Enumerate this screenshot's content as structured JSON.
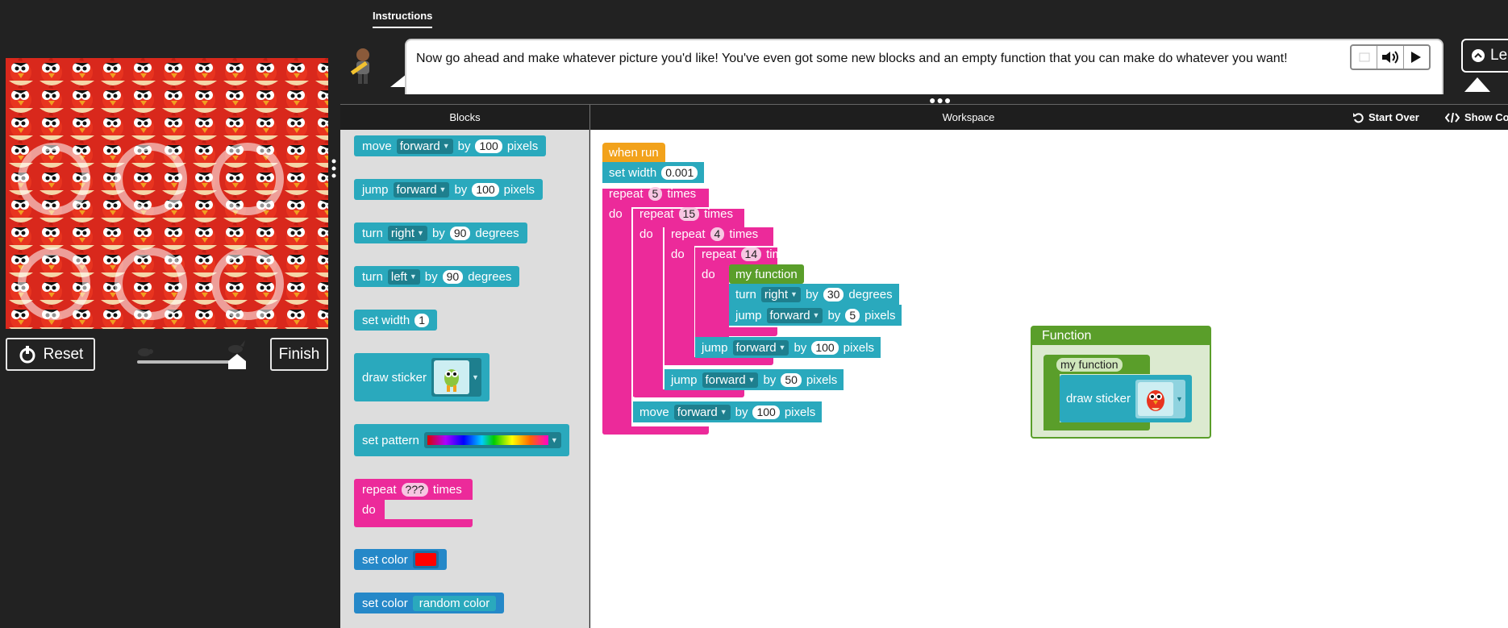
{
  "instructions": {
    "tab_label": "Instructions",
    "text": "Now go ahead and make whatever picture you'd like! You've even got some new blocks and an empty function that you can make do whatever you want!",
    "learn_label": "Le"
  },
  "stage": {
    "reset_label": "Reset",
    "finish_label": "Finish",
    "speed_level": 1.0
  },
  "header": {
    "blocks_label": "Blocks",
    "workspace_label": "Workspace",
    "start_over_label": "Start Over",
    "show_code_label": "Show Co"
  },
  "toolbox": {
    "move": {
      "label": "move",
      "dir": "forward",
      "by": "by",
      "value": "100",
      "unit": "pixels"
    },
    "jump": {
      "label": "jump",
      "dir": "forward",
      "by": "by",
      "value": "100",
      "unit": "pixels"
    },
    "turn_right": {
      "label": "turn",
      "dir": "right",
      "by": "by",
      "value": "90",
      "unit": "degrees"
    },
    "turn_left": {
      "label": "turn",
      "dir": "left",
      "by": "by",
      "value": "90",
      "unit": "degrees"
    },
    "set_width": {
      "label": "set width",
      "value": "1"
    },
    "draw_sticker": {
      "label": "draw sticker"
    },
    "set_pattern": {
      "label": "set pattern"
    },
    "repeat": {
      "label": "repeat",
      "value": "???",
      "unit": "times",
      "do": "do"
    },
    "set_color": {
      "label": "set color",
      "color": "#ff0000"
    },
    "set_color_random": {
      "label": "set color",
      "value": "random color"
    }
  },
  "workspace": {
    "when_run": "when run",
    "set_width": {
      "label": "set width",
      "value": "0.001"
    },
    "repeat1": {
      "label": "repeat",
      "value": "5",
      "unit": "times",
      "do": "do"
    },
    "repeat2": {
      "label": "repeat",
      "value": "15",
      "unit": "times",
      "do": "do"
    },
    "repeat3": {
      "label": "repeat",
      "value": "4",
      "unit": "times",
      "do": "do"
    },
    "repeat4": {
      "label": "repeat",
      "value": "14",
      "unit": "times",
      "do": "do"
    },
    "my_function_call": "my function",
    "turn": {
      "label": "turn",
      "dir": "right",
      "by": "by",
      "value": "30",
      "unit": "degrees"
    },
    "jump_inner": {
      "label": "jump",
      "dir": "forward",
      "by": "by",
      "value": "5",
      "unit": "pixels"
    },
    "jump_100": {
      "label": "jump",
      "dir": "forward",
      "by": "by",
      "value": "100",
      "unit": "pixels"
    },
    "jump_50": {
      "label": "jump",
      "dir": "forward",
      "by": "by",
      "value": "50",
      "unit": "pixels"
    },
    "move_100": {
      "label": "move",
      "dir": "forward",
      "by": "by",
      "value": "100",
      "unit": "pixels"
    },
    "function_panel": {
      "title": "Function",
      "name": "my function",
      "draw_sticker": "draw sticker"
    }
  },
  "colors": {
    "teal": "#2aa9bd",
    "pink": "#ec2a9a",
    "orange": "#f2a21b",
    "green": "#5a9e2a",
    "blue": "#2588c8"
  }
}
